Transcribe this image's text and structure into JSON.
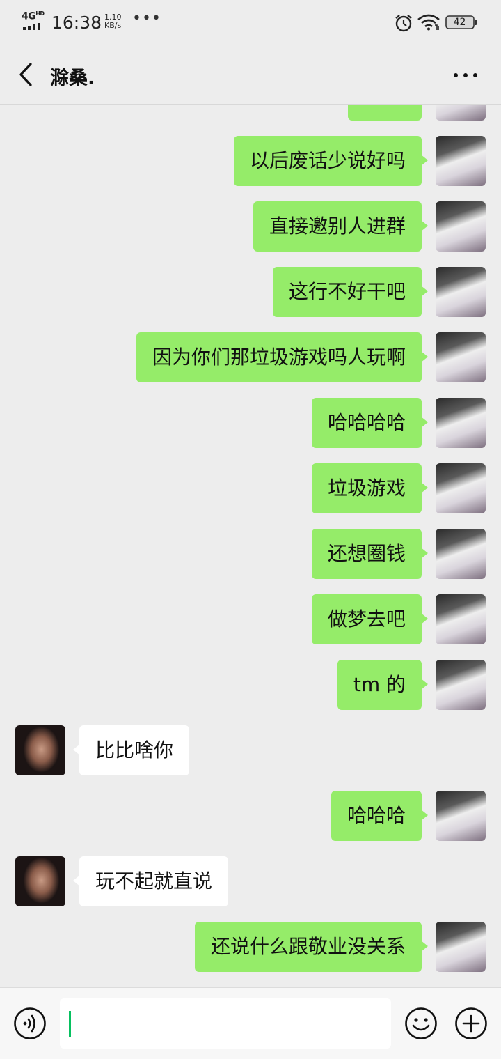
{
  "status_bar": {
    "network": "4G",
    "network_sup": "HD",
    "time": "16:38",
    "speed_value": "1.10",
    "speed_unit": "KB/s",
    "more_dots": "•••",
    "battery": "42"
  },
  "header": {
    "title": "滁桑."
  },
  "messages": [
    {
      "side": "self",
      "text": "以后废话少说好吗"
    },
    {
      "side": "self",
      "text": "直接邀别人进群"
    },
    {
      "side": "self",
      "text": "这行不好干吧"
    },
    {
      "side": "self",
      "text": "因为你们那垃圾游戏吗人玩啊"
    },
    {
      "side": "self",
      "text": "哈哈哈哈"
    },
    {
      "side": "self",
      "text": "垃圾游戏"
    },
    {
      "side": "self",
      "text": "还想圈钱"
    },
    {
      "side": "self",
      "text": "做梦去吧"
    },
    {
      "side": "self",
      "text": "tm 的"
    },
    {
      "side": "other",
      "text": "比比啥你"
    },
    {
      "side": "self",
      "text": "哈哈哈"
    },
    {
      "side": "other",
      "text": "玩不起就直说"
    },
    {
      "side": "self",
      "text": "还说什么跟敬业没关系"
    }
  ],
  "input": {
    "value": ""
  },
  "icons": {
    "back": "chevron-left-icon",
    "more": "more-dots-icon",
    "voice": "voice-icon",
    "emoji": "emoji-icon",
    "plus": "plus-icon"
  },
  "colors": {
    "self_bubble": "#95ec69",
    "other_bubble": "#ffffff",
    "background": "#ededed",
    "caret": "#07c160"
  }
}
